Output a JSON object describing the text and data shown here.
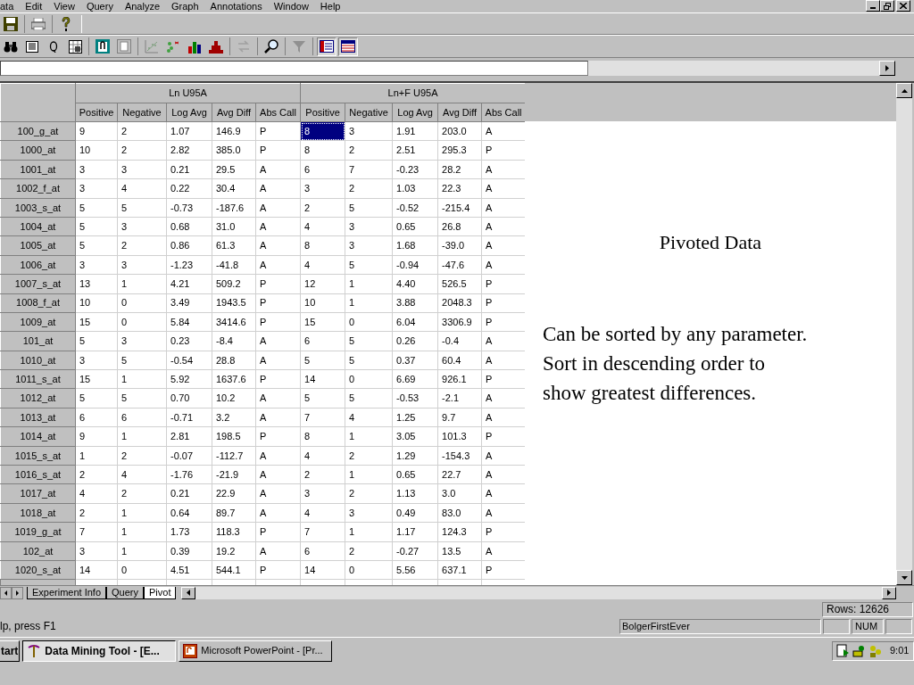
{
  "menu_bar": {
    "items": [
      "ata",
      "Edit",
      "View",
      "Query",
      "Analyze",
      "Graph",
      "Annotations",
      "Window",
      "Help"
    ]
  },
  "grid": {
    "groups": [
      {
        "title": "Ln U95A",
        "columns": [
          "Positive",
          "Negative",
          "Log Avg",
          "Avg Diff",
          "Abs Call"
        ]
      },
      {
        "title": "Ln+F U95A",
        "columns": [
          "Positive",
          "Negative",
          "Log Avg",
          "Avg Diff",
          "Abs Call"
        ]
      }
    ],
    "rows": [
      {
        "probe": "100_g_at",
        "cells": [
          {
            "value": "9",
            "selected": false
          },
          {
            "value": "2",
            "selected": false
          },
          {
            "value": "1.07",
            "selected": false
          },
          {
            "value": "146.9",
            "selected": false
          },
          {
            "value": "P",
            "selected": false
          },
          {
            "value": "8",
            "selected": true
          },
          {
            "value": "3",
            "selected": false
          },
          {
            "value": "1.91",
            "selected": false
          },
          {
            "value": "203.0",
            "selected": false
          },
          {
            "value": "A",
            "selected": false
          }
        ]
      },
      {
        "probe": "1000_at",
        "cells": [
          {
            "value": "10",
            "selected": false
          },
          {
            "value": "2",
            "selected": false
          },
          {
            "value": "2.82",
            "selected": false
          },
          {
            "value": "385.0",
            "selected": false
          },
          {
            "value": "P",
            "selected": false
          },
          {
            "value": "8",
            "selected": false
          },
          {
            "value": "2",
            "selected": false
          },
          {
            "value": "2.51",
            "selected": false
          },
          {
            "value": "295.3",
            "selected": false
          },
          {
            "value": "P",
            "selected": false
          }
        ]
      },
      {
        "probe": "1001_at",
        "cells": [
          {
            "value": "3",
            "selected": false
          },
          {
            "value": "3",
            "selected": false
          },
          {
            "value": "0.21",
            "selected": false
          },
          {
            "value": "29.5",
            "selected": false
          },
          {
            "value": "A",
            "selected": false
          },
          {
            "value": "6",
            "selected": false
          },
          {
            "value": "7",
            "selected": false
          },
          {
            "value": "-0.23",
            "selected": false
          },
          {
            "value": "28.2",
            "selected": false
          },
          {
            "value": "A",
            "selected": false
          }
        ]
      },
      {
        "probe": "1002_f_at",
        "cells": [
          {
            "value": "3",
            "selected": false
          },
          {
            "value": "4",
            "selected": false
          },
          {
            "value": "0.22",
            "selected": false
          },
          {
            "value": "30.4",
            "selected": false
          },
          {
            "value": "A",
            "selected": false
          },
          {
            "value": "3",
            "selected": false
          },
          {
            "value": "2",
            "selected": false
          },
          {
            "value": "1.03",
            "selected": false
          },
          {
            "value": "22.3",
            "selected": false
          },
          {
            "value": "A",
            "selected": false
          }
        ]
      },
      {
        "probe": "1003_s_at",
        "cells": [
          {
            "value": "5",
            "selected": false
          },
          {
            "value": "5",
            "selected": false
          },
          {
            "value": "-0.73",
            "selected": false
          },
          {
            "value": "-187.6",
            "selected": false
          },
          {
            "value": "A",
            "selected": false
          },
          {
            "value": "2",
            "selected": false
          },
          {
            "value": "5",
            "selected": false
          },
          {
            "value": "-0.52",
            "selected": false
          },
          {
            "value": "-215.4",
            "selected": false
          },
          {
            "value": "A",
            "selected": false
          }
        ]
      },
      {
        "probe": "1004_at",
        "cells": [
          {
            "value": "5",
            "selected": false
          },
          {
            "value": "3",
            "selected": false
          },
          {
            "value": "0.68",
            "selected": false
          },
          {
            "value": "31.0",
            "selected": false
          },
          {
            "value": "A",
            "selected": false
          },
          {
            "value": "4",
            "selected": false
          },
          {
            "value": "3",
            "selected": false
          },
          {
            "value": "0.65",
            "selected": false
          },
          {
            "value": "26.8",
            "selected": false
          },
          {
            "value": "A",
            "selected": false
          }
        ]
      },
      {
        "probe": "1005_at",
        "cells": [
          {
            "value": "5",
            "selected": false
          },
          {
            "value": "2",
            "selected": false
          },
          {
            "value": "0.86",
            "selected": false
          },
          {
            "value": "61.3",
            "selected": false
          },
          {
            "value": "A",
            "selected": false
          },
          {
            "value": "8",
            "selected": false
          },
          {
            "value": "3",
            "selected": false
          },
          {
            "value": "1.68",
            "selected": false
          },
          {
            "value": "-39.0",
            "selected": false
          },
          {
            "value": "A",
            "selected": false
          }
        ]
      },
      {
        "probe": "1006_at",
        "cells": [
          {
            "value": "3",
            "selected": false
          },
          {
            "value": "3",
            "selected": false
          },
          {
            "value": "-1.23",
            "selected": false
          },
          {
            "value": "-41.8",
            "selected": false
          },
          {
            "value": "A",
            "selected": false
          },
          {
            "value": "4",
            "selected": false
          },
          {
            "value": "5",
            "selected": false
          },
          {
            "value": "-0.94",
            "selected": false
          },
          {
            "value": "-47.6",
            "selected": false
          },
          {
            "value": "A",
            "selected": false
          }
        ]
      },
      {
        "probe": "1007_s_at",
        "cells": [
          {
            "value": "13",
            "selected": false
          },
          {
            "value": "1",
            "selected": false
          },
          {
            "value": "4.21",
            "selected": false
          },
          {
            "value": "509.2",
            "selected": false
          },
          {
            "value": "P",
            "selected": false
          },
          {
            "value": "12",
            "selected": false
          },
          {
            "value": "1",
            "selected": false
          },
          {
            "value": "4.40",
            "selected": false
          },
          {
            "value": "526.5",
            "selected": false
          },
          {
            "value": "P",
            "selected": false
          }
        ]
      },
      {
        "probe": "1008_f_at",
        "cells": [
          {
            "value": "10",
            "selected": false
          },
          {
            "value": "0",
            "selected": false
          },
          {
            "value": "3.49",
            "selected": false
          },
          {
            "value": "1943.5",
            "selected": false
          },
          {
            "value": "P",
            "selected": false
          },
          {
            "value": "10",
            "selected": false
          },
          {
            "value": "1",
            "selected": false
          },
          {
            "value": "3.88",
            "selected": false
          },
          {
            "value": "2048.3",
            "selected": false
          },
          {
            "value": "P",
            "selected": false
          }
        ]
      },
      {
        "probe": "1009_at",
        "cells": [
          {
            "value": "15",
            "selected": false
          },
          {
            "value": "0",
            "selected": false
          },
          {
            "value": "5.84",
            "selected": false
          },
          {
            "value": "3414.6",
            "selected": false
          },
          {
            "value": "P",
            "selected": false
          },
          {
            "value": "15",
            "selected": false
          },
          {
            "value": "0",
            "selected": false
          },
          {
            "value": "6.04",
            "selected": false
          },
          {
            "value": "3306.9",
            "selected": false
          },
          {
            "value": "P",
            "selected": false
          }
        ]
      },
      {
        "probe": "101_at",
        "cells": [
          {
            "value": "5",
            "selected": false
          },
          {
            "value": "3",
            "selected": false
          },
          {
            "value": "0.23",
            "selected": false
          },
          {
            "value": "-8.4",
            "selected": false
          },
          {
            "value": "A",
            "selected": false
          },
          {
            "value": "6",
            "selected": false
          },
          {
            "value": "5",
            "selected": false
          },
          {
            "value": "0.26",
            "selected": false
          },
          {
            "value": "-0.4",
            "selected": false
          },
          {
            "value": "A",
            "selected": false
          }
        ]
      },
      {
        "probe": "1010_at",
        "cells": [
          {
            "value": "3",
            "selected": false
          },
          {
            "value": "5",
            "selected": false
          },
          {
            "value": "-0.54",
            "selected": false
          },
          {
            "value": "28.8",
            "selected": false
          },
          {
            "value": "A",
            "selected": false
          },
          {
            "value": "5",
            "selected": false
          },
          {
            "value": "5",
            "selected": false
          },
          {
            "value": "0.37",
            "selected": false
          },
          {
            "value": "60.4",
            "selected": false
          },
          {
            "value": "A",
            "selected": false
          }
        ]
      },
      {
        "probe": "1011_s_at",
        "cells": [
          {
            "value": "15",
            "selected": false
          },
          {
            "value": "1",
            "selected": false
          },
          {
            "value": "5.92",
            "selected": false
          },
          {
            "value": "1637.6",
            "selected": false
          },
          {
            "value": "P",
            "selected": false
          },
          {
            "value": "14",
            "selected": false
          },
          {
            "value": "0",
            "selected": false
          },
          {
            "value": "6.69",
            "selected": false
          },
          {
            "value": "926.1",
            "selected": false
          },
          {
            "value": "P",
            "selected": false
          }
        ]
      },
      {
        "probe": "1012_at",
        "cells": [
          {
            "value": "5",
            "selected": false
          },
          {
            "value": "5",
            "selected": false
          },
          {
            "value": "0.70",
            "selected": false
          },
          {
            "value": "10.2",
            "selected": false
          },
          {
            "value": "A",
            "selected": false
          },
          {
            "value": "5",
            "selected": false
          },
          {
            "value": "5",
            "selected": false
          },
          {
            "value": "-0.53",
            "selected": false
          },
          {
            "value": "-2.1",
            "selected": false
          },
          {
            "value": "A",
            "selected": false
          }
        ]
      },
      {
        "probe": "1013_at",
        "cells": [
          {
            "value": "6",
            "selected": false
          },
          {
            "value": "6",
            "selected": false
          },
          {
            "value": "-0.71",
            "selected": false
          },
          {
            "value": "3.2",
            "selected": false
          },
          {
            "value": "A",
            "selected": false
          },
          {
            "value": "7",
            "selected": false
          },
          {
            "value": "4",
            "selected": false
          },
          {
            "value": "1.25",
            "selected": false
          },
          {
            "value": "9.7",
            "selected": false
          },
          {
            "value": "A",
            "selected": false
          }
        ]
      },
      {
        "probe": "1014_at",
        "cells": [
          {
            "value": "9",
            "selected": false
          },
          {
            "value": "1",
            "selected": false
          },
          {
            "value": "2.81",
            "selected": false
          },
          {
            "value": "198.5",
            "selected": false
          },
          {
            "value": "P",
            "selected": false
          },
          {
            "value": "8",
            "selected": false
          },
          {
            "value": "1",
            "selected": false
          },
          {
            "value": "3.05",
            "selected": false
          },
          {
            "value": "101.3",
            "selected": false
          },
          {
            "value": "P",
            "selected": false
          }
        ]
      },
      {
        "probe": "1015_s_at",
        "cells": [
          {
            "value": "1",
            "selected": false
          },
          {
            "value": "2",
            "selected": false
          },
          {
            "value": "-0.07",
            "selected": false
          },
          {
            "value": "-112.7",
            "selected": false
          },
          {
            "value": "A",
            "selected": false
          },
          {
            "value": "4",
            "selected": false
          },
          {
            "value": "2",
            "selected": false
          },
          {
            "value": "1.29",
            "selected": false
          },
          {
            "value": "-154.3",
            "selected": false
          },
          {
            "value": "A",
            "selected": false
          }
        ]
      },
      {
        "probe": "1016_s_at",
        "cells": [
          {
            "value": "2",
            "selected": false
          },
          {
            "value": "4",
            "selected": false
          },
          {
            "value": "-1.76",
            "selected": false
          },
          {
            "value": "-21.9",
            "selected": false
          },
          {
            "value": "A",
            "selected": false
          },
          {
            "value": "2",
            "selected": false
          },
          {
            "value": "1",
            "selected": false
          },
          {
            "value": "0.65",
            "selected": false
          },
          {
            "value": "22.7",
            "selected": false
          },
          {
            "value": "A",
            "selected": false
          }
        ]
      },
      {
        "probe": "1017_at",
        "cells": [
          {
            "value": "4",
            "selected": false
          },
          {
            "value": "2",
            "selected": false
          },
          {
            "value": "0.21",
            "selected": false
          },
          {
            "value": "22.9",
            "selected": false
          },
          {
            "value": "A",
            "selected": false
          },
          {
            "value": "3",
            "selected": false
          },
          {
            "value": "2",
            "selected": false
          },
          {
            "value": "1.13",
            "selected": false
          },
          {
            "value": "3.0",
            "selected": false
          },
          {
            "value": "A",
            "selected": false
          }
        ]
      },
      {
        "probe": "1018_at",
        "cells": [
          {
            "value": "2",
            "selected": false
          },
          {
            "value": "1",
            "selected": false
          },
          {
            "value": "0.64",
            "selected": false
          },
          {
            "value": "89.7",
            "selected": false
          },
          {
            "value": "A",
            "selected": false
          },
          {
            "value": "4",
            "selected": false
          },
          {
            "value": "3",
            "selected": false
          },
          {
            "value": "0.49",
            "selected": false
          },
          {
            "value": "83.0",
            "selected": false
          },
          {
            "value": "A",
            "selected": false
          }
        ]
      },
      {
        "probe": "1019_g_at",
        "cells": [
          {
            "value": "7",
            "selected": false
          },
          {
            "value": "1",
            "selected": false
          },
          {
            "value": "1.73",
            "selected": false
          },
          {
            "value": "118.3",
            "selected": false
          },
          {
            "value": "P",
            "selected": false
          },
          {
            "value": "7",
            "selected": false
          },
          {
            "value": "1",
            "selected": false
          },
          {
            "value": "1.17",
            "selected": false
          },
          {
            "value": "124.3",
            "selected": false
          },
          {
            "value": "P",
            "selected": false
          }
        ]
      },
      {
        "probe": "102_at",
        "cells": [
          {
            "value": "3",
            "selected": false
          },
          {
            "value": "1",
            "selected": false
          },
          {
            "value": "0.39",
            "selected": false
          },
          {
            "value": "19.2",
            "selected": false
          },
          {
            "value": "A",
            "selected": false
          },
          {
            "value": "6",
            "selected": false
          },
          {
            "value": "2",
            "selected": false
          },
          {
            "value": "-0.27",
            "selected": false
          },
          {
            "value": "13.5",
            "selected": false
          },
          {
            "value": "A",
            "selected": false
          }
        ]
      },
      {
        "probe": "1020_s_at",
        "cells": [
          {
            "value": "14",
            "selected": false
          },
          {
            "value": "0",
            "selected": false
          },
          {
            "value": "4.51",
            "selected": false
          },
          {
            "value": "544.1",
            "selected": false
          },
          {
            "value": "P",
            "selected": false
          },
          {
            "value": "14",
            "selected": false
          },
          {
            "value": "0",
            "selected": false
          },
          {
            "value": "5.56",
            "selected": false
          },
          {
            "value": "637.1",
            "selected": false
          },
          {
            "value": "P",
            "selected": false
          }
        ]
      }
    ]
  },
  "annotation": {
    "title": "Pivoted Data",
    "lines": [
      "Can be sorted by any parameter.",
      "Sort in descending order to",
      "show greatest differences."
    ]
  },
  "sheet_tabs": [
    {
      "label": "Experiment Info",
      "selected": false
    },
    {
      "label": "Query",
      "selected": false
    },
    {
      "label": "Pivot",
      "selected": true
    }
  ],
  "status_bar": {
    "rows": "Rows: 12626",
    "help": "lp, press F1",
    "user": "BolgerFirstEver",
    "num": "NUM"
  },
  "taskbar": {
    "start": "tart",
    "tasks": [
      {
        "label": "Data Mining Tool - [E...",
        "selected": true
      },
      {
        "label": "Microsoft PowerPoint - [Pr...",
        "selected": false
      }
    ],
    "clock": "9:01"
  }
}
